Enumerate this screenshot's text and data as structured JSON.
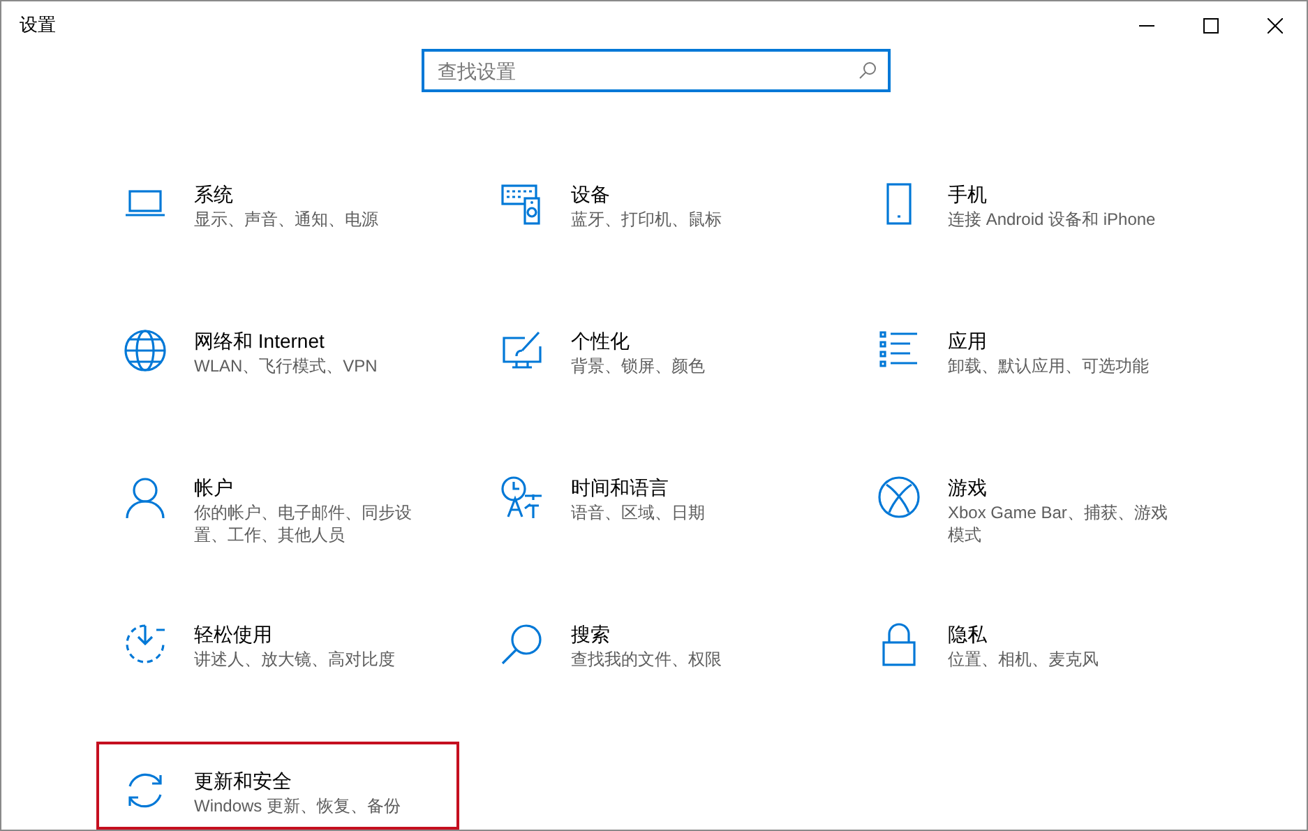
{
  "window": {
    "title": "设置"
  },
  "search": {
    "placeholder": "查找设置"
  },
  "items": [
    {
      "title": "系统",
      "description": "显示、声音、通知、电源",
      "selected": false
    },
    {
      "title": "设备",
      "description": "蓝牙、打印机、鼠标",
      "selected": false
    },
    {
      "title": "手机",
      "description": "连接 Android 设备和 iPhone",
      "selected": false
    },
    {
      "title": "网络和 Internet",
      "description": "WLAN、飞行模式、VPN",
      "selected": false
    },
    {
      "title": "个性化",
      "description": "背景、锁屏、颜色",
      "selected": false
    },
    {
      "title": "应用",
      "description": "卸载、默认应用、可选功能",
      "selected": false
    },
    {
      "title": "帐户",
      "description": "你的帐户、电子邮件、同步设置、工作、其他人员",
      "selected": false
    },
    {
      "title": "时间和语言",
      "description": "语音、区域、日期",
      "selected": false
    },
    {
      "title": "游戏",
      "description": "Xbox Game Bar、捕获、游戏模式",
      "selected": false
    },
    {
      "title": "轻松使用",
      "description": "讲述人、放大镜、高对比度",
      "selected": false
    },
    {
      "title": "搜索",
      "description": "查找我的文件、权限",
      "selected": false
    },
    {
      "title": "隐私",
      "description": "位置、相机、麦克风",
      "selected": false
    },
    {
      "title": "更新和安全",
      "description": "Windows 更新、恢复、备份",
      "selected": true
    }
  ]
}
